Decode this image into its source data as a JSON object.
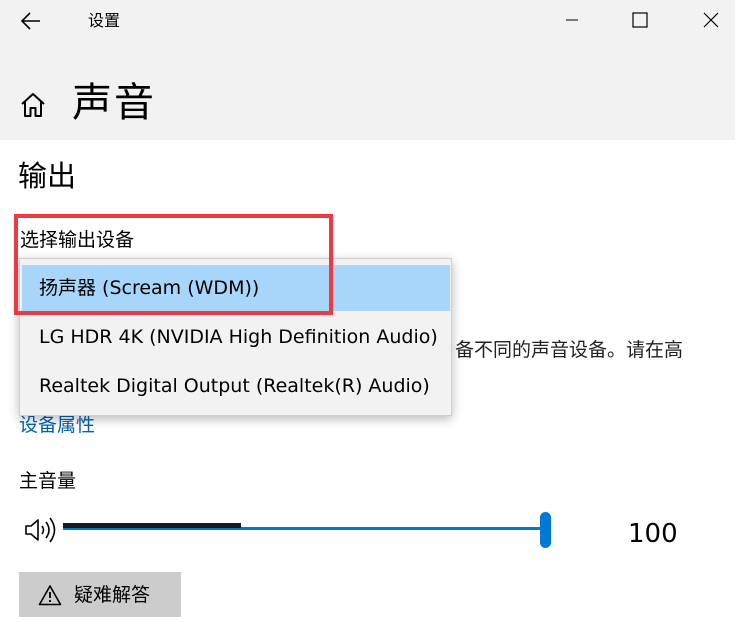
{
  "titlebar": {
    "app_title": "设置",
    "back_icon": "arrow-left-icon",
    "minimize_icon": "minimize-icon",
    "maximize_icon": "maximize-icon",
    "close_icon": "close-icon"
  },
  "header": {
    "home_icon": "home-icon",
    "page_title": "声音"
  },
  "output": {
    "section_title": "输出",
    "device_label": "选择输出设备",
    "devices": [
      {
        "label": "扬声器 (Scream (WDM))",
        "selected": true
      },
      {
        "label": "LG HDR 4K (NVIDIA High Definition Audio)",
        "selected": false
      },
      {
        "label": "Realtek Digital Output (Realtek(R) Audio)",
        "selected": false
      }
    ],
    "partial_description": "备不同的声音设备。请在高",
    "partial_link": "设备属性",
    "volume_label": "主音量",
    "volume_icon": "speaker-icon",
    "volume_value": "100",
    "volume_level": 1.0,
    "troubleshoot_icon": "warning-icon",
    "troubleshoot_label": "疑难解答"
  },
  "colors": {
    "accent": "#0078d7",
    "link": "#0063b1",
    "selected_item": "#a8d6fa",
    "highlight_outline": "#ec3a42",
    "header_background": "#f2f2f2"
  }
}
